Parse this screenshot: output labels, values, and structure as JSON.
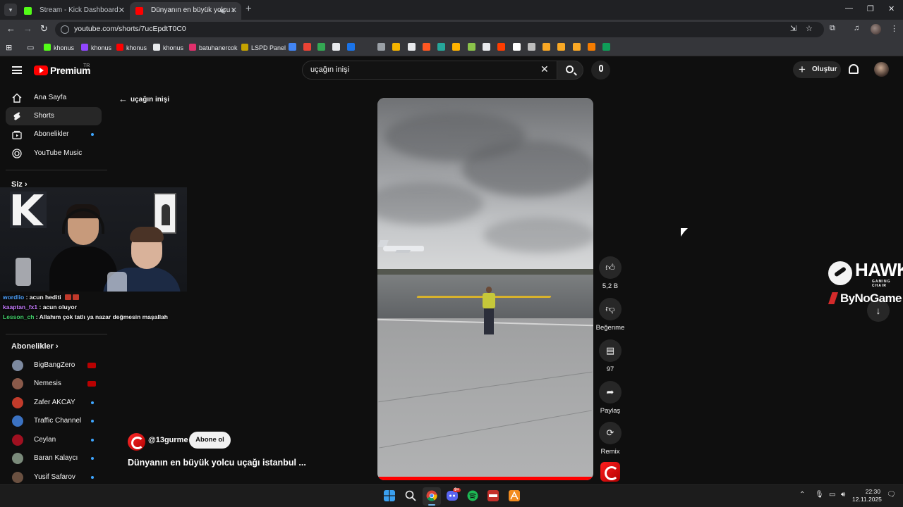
{
  "browser": {
    "tabs": [
      {
        "title": "Stream - Kick Dashboard",
        "active": false,
        "favicon_color": "#53fc18"
      },
      {
        "title": "Dünyanın en büyük yolcu uçağı",
        "active": true,
        "favicon_color": "#ff0000"
      }
    ],
    "url": "youtube.com/shorts/7ucEpdtT0C0",
    "bookmarks": [
      {
        "label": "khonus",
        "icon": "kick-icon",
        "color": "#53fc18"
      },
      {
        "label": "khonus",
        "icon": "twitch-icon",
        "color": "#9146ff"
      },
      {
        "label": "khonus",
        "icon": "youtube-icon",
        "color": "#ff0000"
      },
      {
        "label": "khonus",
        "icon": "x-icon",
        "color": "#e8eaed"
      },
      {
        "label": "batuhanercok",
        "icon": "instagram-icon",
        "color": "#e1306c"
      },
      {
        "label": "LSPD Panel",
        "icon": "lspd-icon",
        "color": "#222222"
      }
    ]
  },
  "youtube": {
    "brand": "Premium",
    "country": "TR",
    "search_query": "uçağın inişi",
    "create_label": "Oluştur"
  },
  "sidebar": {
    "nav": [
      {
        "label": "Ana Sayfa",
        "icon": "home-icon",
        "selected": false,
        "dot": false
      },
      {
        "label": "Shorts",
        "icon": "shorts-icon",
        "selected": true,
        "dot": false
      },
      {
        "label": "Abonelikler",
        "icon": "subscriptions-icon",
        "selected": false,
        "dot": true
      },
      {
        "label": "YouTube Music",
        "icon": "music-icon",
        "selected": false,
        "dot": false
      }
    ],
    "you_heading": "Siz",
    "subs_heading": "Abonelikler",
    "subscriptions": [
      {
        "name": "BigBangZero",
        "status": "live",
        "color": "#7d8aa0"
      },
      {
        "name": "Nemesis",
        "status": "live",
        "color": "#8a5a4a"
      },
      {
        "name": "Zafer AKCAY",
        "status": "new",
        "color": "#c23b2b"
      },
      {
        "name": "Traffic Channel",
        "status": "new",
        "color": "#3b72c2"
      },
      {
        "name": "Ceylan",
        "status": "new",
        "color": "#a01020"
      },
      {
        "name": "Baran Kalaycı",
        "status": "new",
        "color": "#7a8a7a"
      },
      {
        "name": "Yusif Safarov",
        "status": "new",
        "color": "#6a5040"
      }
    ]
  },
  "chat": [
    {
      "user": "wordlio",
      "user_color": "#4fa3ff",
      "message": "acun hediti"
    },
    {
      "user": "kaaptan_fx1",
      "user_color": "#c77dff",
      "message": "acun oluyor"
    },
    {
      "user": "Lesson_ch",
      "user_color": "#44d16b",
      "message": "Allahım çok tatlı ya nazar değmesin maşallah"
    }
  ],
  "shorts": {
    "back_label": "uçağın inişi",
    "channel_handle": "@13gurme",
    "subscribe_label": "Abone ol",
    "title": "Dünyanın en büyük yolcu uçağı istanbul ...",
    "progress": 1.0,
    "actions": [
      {
        "icon": "like-icon",
        "label": "5,2 B"
      },
      {
        "icon": "dislike-icon",
        "label": "Beğenme"
      },
      {
        "icon": "comment-icon",
        "label": "97"
      },
      {
        "icon": "share-icon",
        "label": "Paylaş"
      },
      {
        "icon": "remix-icon",
        "label": "Remix"
      }
    ]
  },
  "sponsor": {
    "brand": "HAWK",
    "tagline": "GAMING CHAIR",
    "partner": "ByNoGame"
  },
  "taskbar": {
    "time": "22:30",
    "date": "12.11.2025",
    "notification_badge": "9+",
    "apps": [
      "windows-icon",
      "search-icon",
      "chrome-icon",
      "discord-icon",
      "spotify-icon",
      "obs-icon",
      "app-icon"
    ]
  }
}
